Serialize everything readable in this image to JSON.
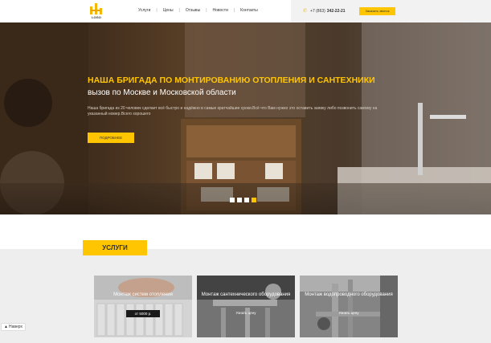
{
  "header": {
    "logo_text": "LOGO",
    "nav": [
      "Услуги",
      "Цены",
      "Отзывы",
      "Новости",
      "Контакты"
    ],
    "phone_prefix": "+7 (863)",
    "phone_number": "342-22-21",
    "call_button": "Заказать звонок"
  },
  "hero": {
    "title": "НАША БРИГАДА ПО МОНТИРОВАНИЮ ОТОПЛЕНИЯ И САНТЕХНИКИ",
    "subtitle": "вызов по Москве и Московской области",
    "description": "Наша бригада из 20 человек сделает всё быстро и надёжно в самые кратчайшие сроки.Всё что Вам нужно это оставить заявку либо позвонить самому на указанный номер.Всего хорошего",
    "button": "ПОДРОБНЕЕ",
    "slides_total": 4,
    "active_slide": 4
  },
  "services": {
    "heading": "УСЛУГИ",
    "cards": [
      {
        "title": "Монтаж систем отопления",
        "price": "от 5000 р."
      },
      {
        "title": "Монтаж сантехнического оборудования",
        "link": "Узнать цену"
      },
      {
        "title": "Монтаж водопроводного оборудования",
        "link": "Узнать цену"
      }
    ]
  },
  "widget": {
    "label": "Наверх"
  },
  "colors": {
    "accent": "#ffc500",
    "hero_bg": "#3a2a1c",
    "section_bg": "#eeeeee"
  }
}
